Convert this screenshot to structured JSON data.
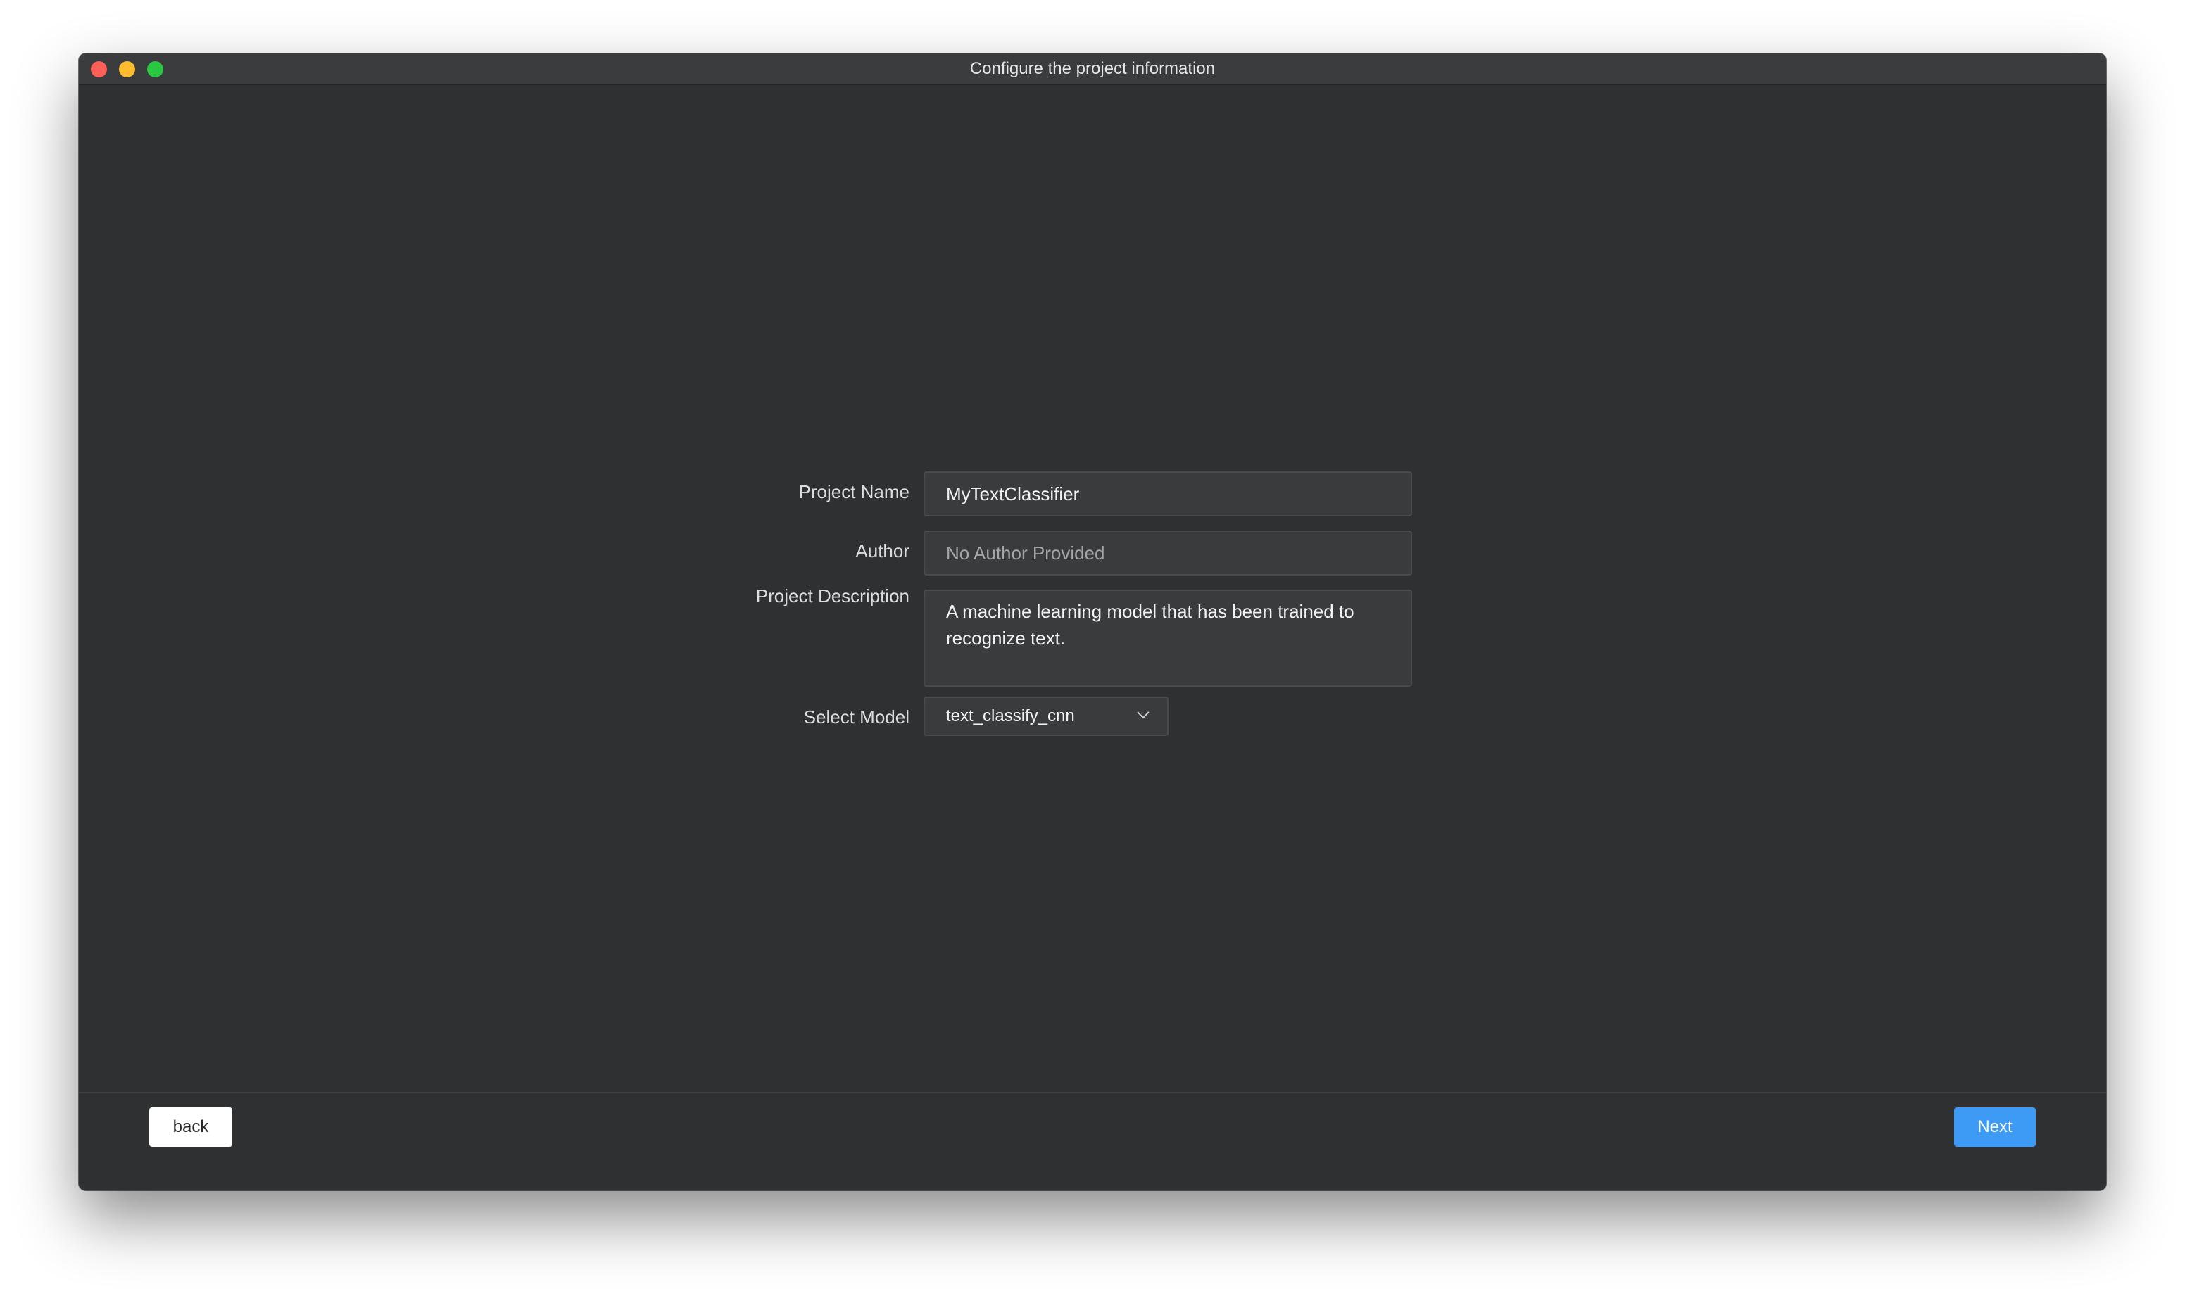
{
  "window": {
    "title": "Configure the project information"
  },
  "form": {
    "project_name": {
      "label": "Project Name",
      "value": "MyTextClassifier",
      "placeholder": ""
    },
    "author": {
      "label": "Author",
      "value": "",
      "placeholder": "No Author Provided"
    },
    "project_description": {
      "label": "Project Description",
      "value": "A machine learning model that has been trained to recognize text."
    },
    "select_model": {
      "label": "Select Model",
      "selected": "text_classify_cnn"
    }
  },
  "footer": {
    "back_label": "back",
    "next_label": "Next"
  },
  "colors": {
    "window_bg": "#2f3032",
    "titlebar_bg": "#3b3c3e",
    "close": "#fe5f57",
    "minimize": "#febc2e",
    "zoom": "#28c840",
    "accent": "#3d9af5"
  },
  "icons": {
    "dropdown": "chevron-down-icon"
  }
}
